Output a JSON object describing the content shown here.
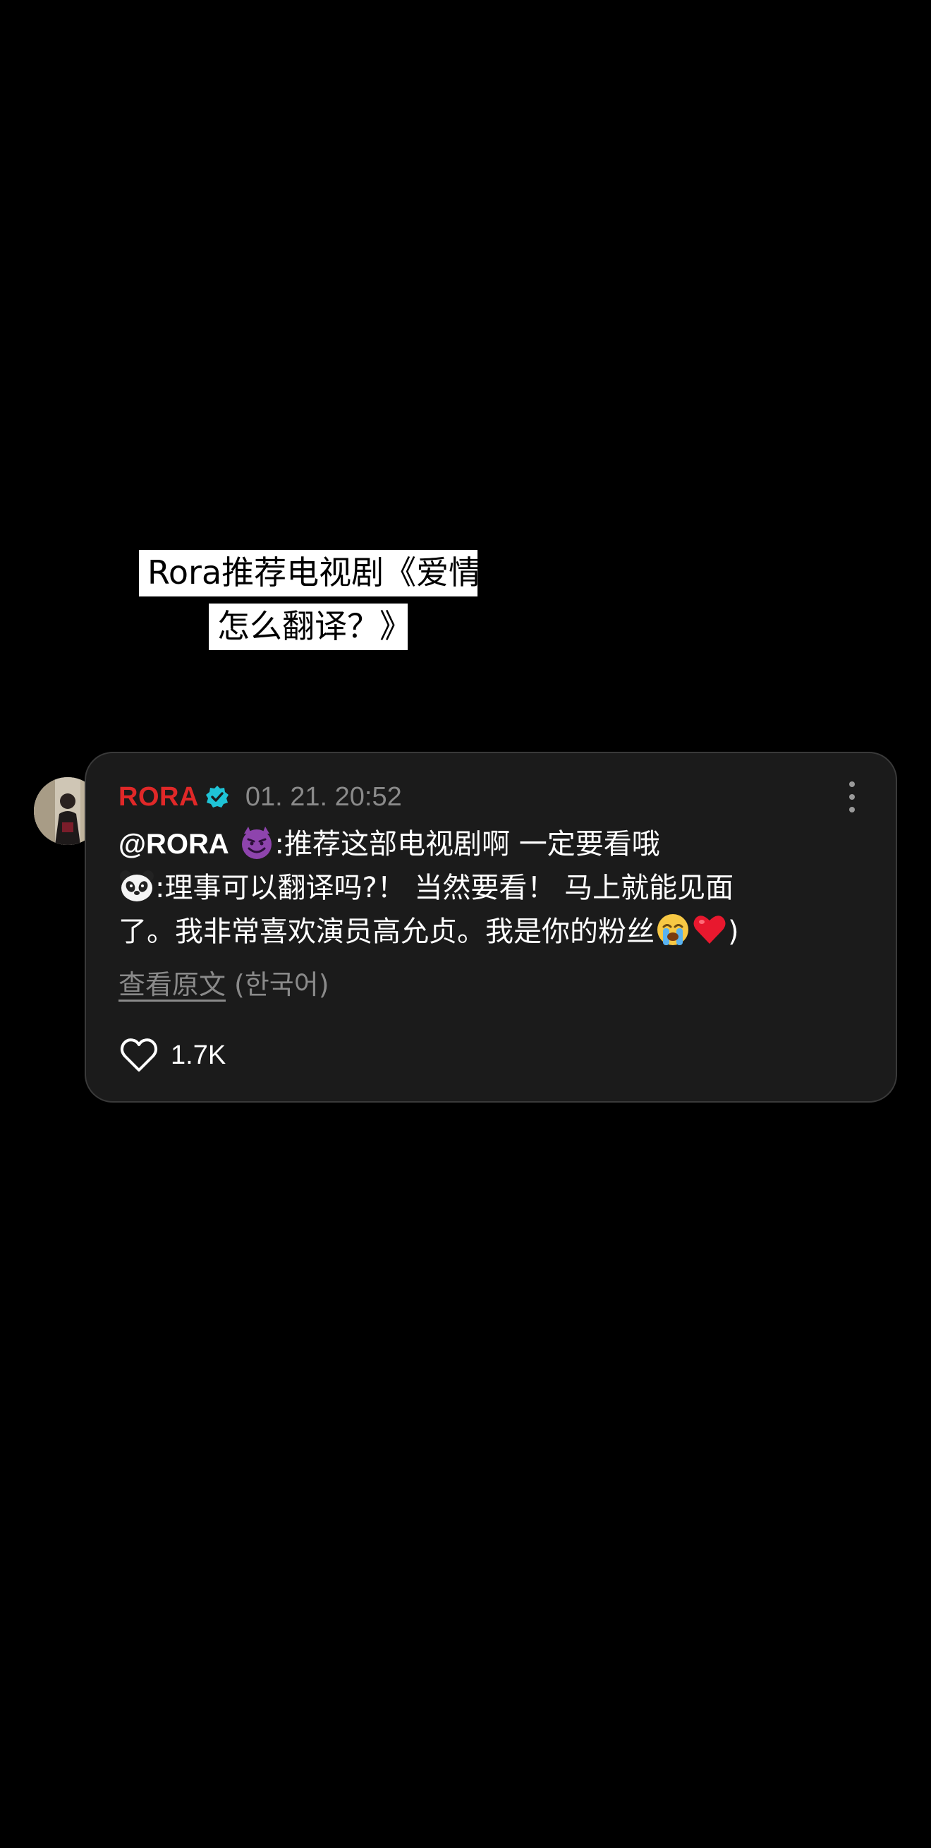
{
  "caption": {
    "line1": "Rora推荐电视剧《爱情",
    "line2": "怎么翻译？》"
  },
  "comment": {
    "author": "RORA",
    "timestamp": "01. 21. 20:52",
    "mention": "@RORA",
    "line1_after_emoji": ":推荐这部电视剧啊 一定要看哦",
    "line2_after_emoji": ":理事可以翻译吗?！ 当然要看！ 马上就能见面",
    "line3_text": "了。我非常喜欢演员高允贞。我是你的粉丝",
    "line3_end": ")",
    "view_original": "查看原文",
    "language": "(한국어)",
    "likes": "1.7K"
  },
  "icons": {
    "verified": "verified-badge-icon",
    "more": "more-vertical-icon",
    "like": "heart-outline-icon",
    "emoji_1": "smiling-devil-emoji",
    "emoji_2": "panda-emoji",
    "emoji_3": "loudly-crying-emoji",
    "emoji_4": "red-heart-emoji"
  },
  "colors": {
    "background": "#000000",
    "card": "#1b1b1b",
    "author": "#e02828",
    "verified": "#1fc3d6",
    "muted": "#8a8a8a"
  }
}
